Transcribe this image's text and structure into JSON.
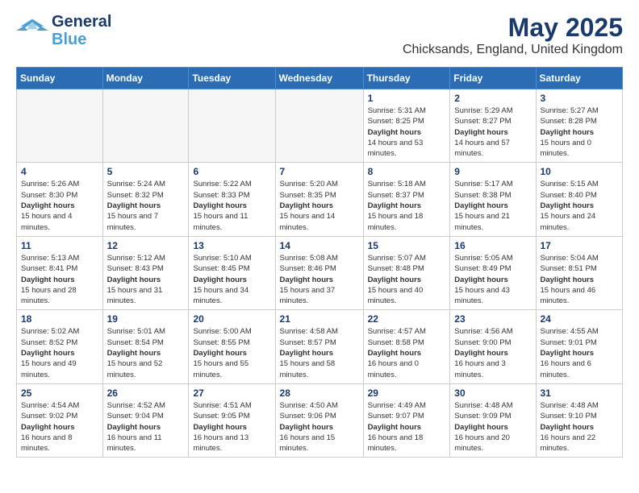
{
  "header": {
    "logo_line1": "General",
    "logo_line2": "Blue",
    "title": "May 2025",
    "subtitle": "Chicksands, England, United Kingdom"
  },
  "weekdays": [
    "Sunday",
    "Monday",
    "Tuesday",
    "Wednesday",
    "Thursday",
    "Friday",
    "Saturday"
  ],
  "weeks": [
    [
      {
        "day": "",
        "empty": true
      },
      {
        "day": "",
        "empty": true
      },
      {
        "day": "",
        "empty": true
      },
      {
        "day": "",
        "empty": true
      },
      {
        "day": "1",
        "sunrise": "5:31 AM",
        "sunset": "8:25 PM",
        "daylight": "14 hours and 53 minutes."
      },
      {
        "day": "2",
        "sunrise": "5:29 AM",
        "sunset": "8:27 PM",
        "daylight": "14 hours and 57 minutes."
      },
      {
        "day": "3",
        "sunrise": "5:27 AM",
        "sunset": "8:28 PM",
        "daylight": "15 hours and 0 minutes."
      }
    ],
    [
      {
        "day": "4",
        "sunrise": "5:26 AM",
        "sunset": "8:30 PM",
        "daylight": "15 hours and 4 minutes."
      },
      {
        "day": "5",
        "sunrise": "5:24 AM",
        "sunset": "8:32 PM",
        "daylight": "15 hours and 7 minutes."
      },
      {
        "day": "6",
        "sunrise": "5:22 AM",
        "sunset": "8:33 PM",
        "daylight": "15 hours and 11 minutes."
      },
      {
        "day": "7",
        "sunrise": "5:20 AM",
        "sunset": "8:35 PM",
        "daylight": "15 hours and 14 minutes."
      },
      {
        "day": "8",
        "sunrise": "5:18 AM",
        "sunset": "8:37 PM",
        "daylight": "15 hours and 18 minutes."
      },
      {
        "day": "9",
        "sunrise": "5:17 AM",
        "sunset": "8:38 PM",
        "daylight": "15 hours and 21 minutes."
      },
      {
        "day": "10",
        "sunrise": "5:15 AM",
        "sunset": "8:40 PM",
        "daylight": "15 hours and 24 minutes."
      }
    ],
    [
      {
        "day": "11",
        "sunrise": "5:13 AM",
        "sunset": "8:41 PM",
        "daylight": "15 hours and 28 minutes."
      },
      {
        "day": "12",
        "sunrise": "5:12 AM",
        "sunset": "8:43 PM",
        "daylight": "15 hours and 31 minutes."
      },
      {
        "day": "13",
        "sunrise": "5:10 AM",
        "sunset": "8:45 PM",
        "daylight": "15 hours and 34 minutes."
      },
      {
        "day": "14",
        "sunrise": "5:08 AM",
        "sunset": "8:46 PM",
        "daylight": "15 hours and 37 minutes."
      },
      {
        "day": "15",
        "sunrise": "5:07 AM",
        "sunset": "8:48 PM",
        "daylight": "15 hours and 40 minutes."
      },
      {
        "day": "16",
        "sunrise": "5:05 AM",
        "sunset": "8:49 PM",
        "daylight": "15 hours and 43 minutes."
      },
      {
        "day": "17",
        "sunrise": "5:04 AM",
        "sunset": "8:51 PM",
        "daylight": "15 hours and 46 minutes."
      }
    ],
    [
      {
        "day": "18",
        "sunrise": "5:02 AM",
        "sunset": "8:52 PM",
        "daylight": "15 hours and 49 minutes."
      },
      {
        "day": "19",
        "sunrise": "5:01 AM",
        "sunset": "8:54 PM",
        "daylight": "15 hours and 52 minutes."
      },
      {
        "day": "20",
        "sunrise": "5:00 AM",
        "sunset": "8:55 PM",
        "daylight": "15 hours and 55 minutes."
      },
      {
        "day": "21",
        "sunrise": "4:58 AM",
        "sunset": "8:57 PM",
        "daylight": "15 hours and 58 minutes."
      },
      {
        "day": "22",
        "sunrise": "4:57 AM",
        "sunset": "8:58 PM",
        "daylight": "16 hours and 0 minutes."
      },
      {
        "day": "23",
        "sunrise": "4:56 AM",
        "sunset": "9:00 PM",
        "daylight": "16 hours and 3 minutes."
      },
      {
        "day": "24",
        "sunrise": "4:55 AM",
        "sunset": "9:01 PM",
        "daylight": "16 hours and 6 minutes."
      }
    ],
    [
      {
        "day": "25",
        "sunrise": "4:54 AM",
        "sunset": "9:02 PM",
        "daylight": "16 hours and 8 minutes."
      },
      {
        "day": "26",
        "sunrise": "4:52 AM",
        "sunset": "9:04 PM",
        "daylight": "16 hours and 11 minutes."
      },
      {
        "day": "27",
        "sunrise": "4:51 AM",
        "sunset": "9:05 PM",
        "daylight": "16 hours and 13 minutes."
      },
      {
        "day": "28",
        "sunrise": "4:50 AM",
        "sunset": "9:06 PM",
        "daylight": "16 hours and 15 minutes."
      },
      {
        "day": "29",
        "sunrise": "4:49 AM",
        "sunset": "9:07 PM",
        "daylight": "16 hours and 18 minutes."
      },
      {
        "day": "30",
        "sunrise": "4:48 AM",
        "sunset": "9:09 PM",
        "daylight": "16 hours and 20 minutes."
      },
      {
        "day": "31",
        "sunrise": "4:48 AM",
        "sunset": "9:10 PM",
        "daylight": "16 hours and 22 minutes."
      }
    ]
  ]
}
